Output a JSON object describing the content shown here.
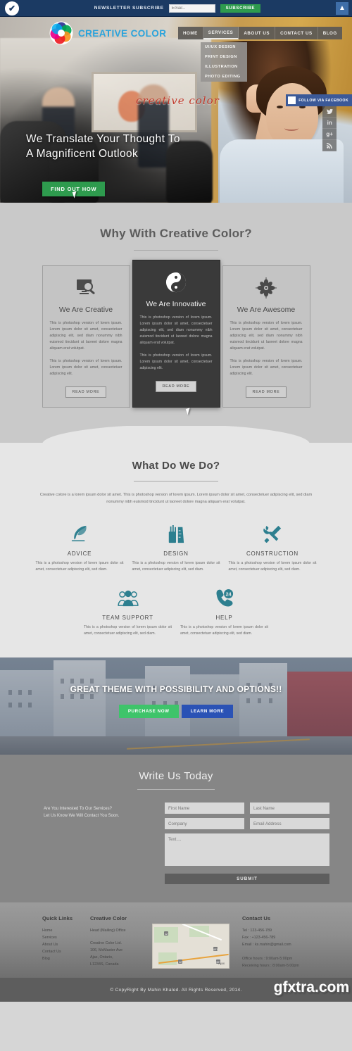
{
  "topbar": {
    "logo_icon": "check-circle-icon",
    "newsletter_label": "NEWSLETTER SUBSCRIBE",
    "email_placeholder": "Email...",
    "email_value": "",
    "subscribe_label": "SUBSCRIBE",
    "scroll_top_icon": "chevron-up-icon",
    "bg_color": "#1b3a63",
    "accent_green": "#2e9b4e"
  },
  "header": {
    "brand": "CREATIVE COLOR",
    "brand_color": "#29a3dc",
    "logo_icon": "color-wheel-icon",
    "nav": [
      {
        "label": "HOME",
        "active": false
      },
      {
        "label": "SERVICES",
        "active": true
      },
      {
        "label": "ABOUT US",
        "active": false
      },
      {
        "label": "CONTACT US",
        "active": false
      },
      {
        "label": "BLOG",
        "active": false
      }
    ],
    "dropdown": [
      "UI/UX DESIGN",
      "PRINT DESIGN",
      "ILLUSTRATION",
      "PHOTO EDITING"
    ]
  },
  "hero": {
    "script_text": "creative color",
    "headline_line1": "We Translate Your Thought To",
    "headline_line2": "A Magnificent Outlook",
    "cta_label": "FIND OUT HOW",
    "slider_dots": 4,
    "slider_active_index": 1
  },
  "social": {
    "facebook_label": "FOLLOW VIA FACEBOOK",
    "facebook_color": "#3b5998",
    "items": [
      {
        "name": "twitter-icon",
        "glyph": "ᵛ"
      },
      {
        "name": "linkedin-icon",
        "glyph": "in"
      },
      {
        "name": "google-plus-icon",
        "glyph": "g+"
      },
      {
        "name": "rss-icon",
        "glyph": "◔"
      }
    ]
  },
  "why": {
    "title": "Why With Creative Color?",
    "cards": [
      {
        "title": "We Are Creative",
        "icon": "monitor-magnifier-icon",
        "p1": "This is photoshop version of lorem ipsum. Lorem ipsum dolor sit amet, consectetuer adipiscing elit, sed diam nonummy nibh euismod tincidunt ut laoreet dolore magna aliquam erat volutpat.",
        "p2": "This is photoshop version of lorem ipsum. Lorem ipsum dolor sit amet, consectetuer adipiscing elit.",
        "button": "READ MORE",
        "dark": false
      },
      {
        "title": "We Are Innovative",
        "icon": "yin-yang-icon",
        "p1": "This is photoshop version of lorem ipsum. Lorem ipsum dolor sit amet, consectetuer adipiscing elit, sed diam nonummy nibh euismod tincidunt ut laoreet dolore magna aliquam erat volutpat.",
        "p2": "This is photoshop version of lorem ipsum. Lorem ipsum dolor sit amet, consectetuer adipiscing elit.",
        "button": "READ MORE",
        "dark": true
      },
      {
        "title": "We Are Awesome",
        "icon": "flower-burst-icon",
        "p1": "This is photoshop version of lorem ipsum. Lorem ipsum dolor sit amet, consectetuer adipiscing elit, sed diam nonummy nibh euismod tincidunt ut laoreet dolore magna aliquam erat volutpat.",
        "p2": "This is photoshop version of lorem ipsum. Lorem ipsum dolor sit amet, consectetuer adipiscing elit.",
        "button": "READ MORE",
        "dark": false
      }
    ]
  },
  "whatdo": {
    "title": "What Do We Do?",
    "description": "Creative colore is a lorem ipsum dolor sit amet. This is photoshop version of lorem ipsum. Lorem ipsum dolor sit amet, consectetuer adipiscing elit, sed diam nonummy nibh euismod tincidunt ut laoreet dolore magna aliquam erat volutpat.",
    "icon_color": "#2d7f8f",
    "services": [
      {
        "name": "ADVICE",
        "icon": "feather-quill-icon",
        "text": "This is a photoshop version of lorem ipsum dolor sit amet, consectetuer adipiscing elit, sed diam."
      },
      {
        "name": "DESIGN",
        "icon": "pens-ruler-icon",
        "text": "This is a photoshop version of lorem ipsum dolor sit amet, consectetuer adipiscing elit, sed diam."
      },
      {
        "name": "CONSTRUCTION",
        "icon": "wrench-screwdriver-icon",
        "text": "This is a photoshop version of lorem ipsum dolor sit amet, consectetuer adipiscing elit, sed diam."
      },
      {
        "name": "TEAM SUPPORT",
        "icon": "people-group-icon",
        "text": "This is a photoshop version of lorem ipsum dolor sit amet, consectetuer adipiscing elit, sed diam."
      },
      {
        "name": "HELP",
        "icon": "phone-24h-icon",
        "text": "This is a photoshop version of lorem ipsum dolor sit amet, consectetuer adipiscing elit, sed diam."
      }
    ]
  },
  "banner": {
    "headline": "GREAT THEME WITH POSSIBILITY AND OPTIONS!!",
    "purchase_label": "PURCHASE NOW",
    "learn_label": "LEARN MORE",
    "purchase_color": "#3ec46a",
    "learn_color": "#2a52b5"
  },
  "contact": {
    "title": "Write Us Today",
    "lead_line1": "Are You Interested To Our Services?",
    "lead_line2": "Let Us Know We Will Contact You Soon.",
    "fields": {
      "first_name": "First Name",
      "last_name": "Last Name",
      "company": "Company",
      "email": "Email Address",
      "message": "Text...."
    },
    "submit_label": "SUBMIT"
  },
  "footer": {
    "quick_links_title": "Quick Links",
    "quick_links": [
      "Home",
      "Services",
      "About Us",
      "Contact Us",
      "Blog"
    ],
    "company_title": "Creative Color",
    "office_label": "Head (Mailing) Office",
    "address_lines": [
      "Creative Color Ltd.",
      "106, McMaster Ave",
      "Ajax, Ontario,",
      "L1234S, Canada"
    ],
    "map_label": "Ajax",
    "contact_title": "Contact Us",
    "tel": "Tel : 123-456-789",
    "fax": "Fax : +123-456-789",
    "email": "Email : ks.mahin@gmail.com",
    "office_hours": "Office hours : 9:00am-5:00pm",
    "receiving_hours": "Receiving hours : 8:00am-5:00pm"
  },
  "copyright": {
    "text": "© CopyRight By Mahin Khaled. All Rights Reserved, 2014.",
    "watermark": "gfxtra.com"
  }
}
